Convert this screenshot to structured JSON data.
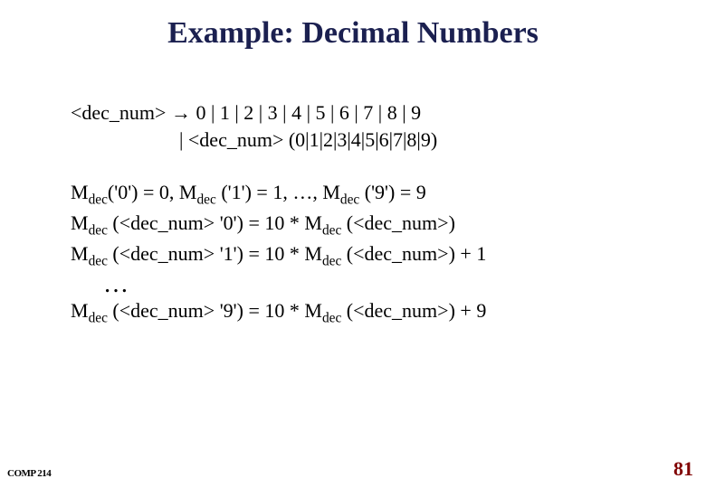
{
  "title": "Example: Decimal Numbers",
  "grammar": {
    "line1": "<dec_num> → 0 | 1 | 2 | 3 | 4 | 5 | 6 | 7 | 8 | 9",
    "line2": "| <dec_num> (0|1|2|3|4|5|6|7|8|9)"
  },
  "sem": {
    "l1a": "M",
    "l1b": "dec",
    "l1c": "('0') = 0,  M",
    "l1d": "dec",
    "l1e": " ('1') = 1, …,  M",
    "l1f": "dec",
    "l1g": " ('9') = 9",
    "l2a": "M",
    "l2b": "dec",
    "l2c": " (<dec_num> '0') = 10 * M",
    "l2d": "dec",
    "l2e": " (<dec_num>)",
    "l3a": "M",
    "l3b": "dec",
    "l3c": " (<dec_num> '1') = 10 * M",
    "l3d": "dec",
    "l3e": " (<dec_num>) + 1",
    "ellipsis": "…",
    "l4a": "M",
    "l4b": "dec",
    "l4c": " (<dec_num> '9') = 10 * M",
    "l4d": "dec",
    "l4e": " (<dec_num>) + 9"
  },
  "footer": {
    "left": "COMP 214",
    "right": "81"
  }
}
